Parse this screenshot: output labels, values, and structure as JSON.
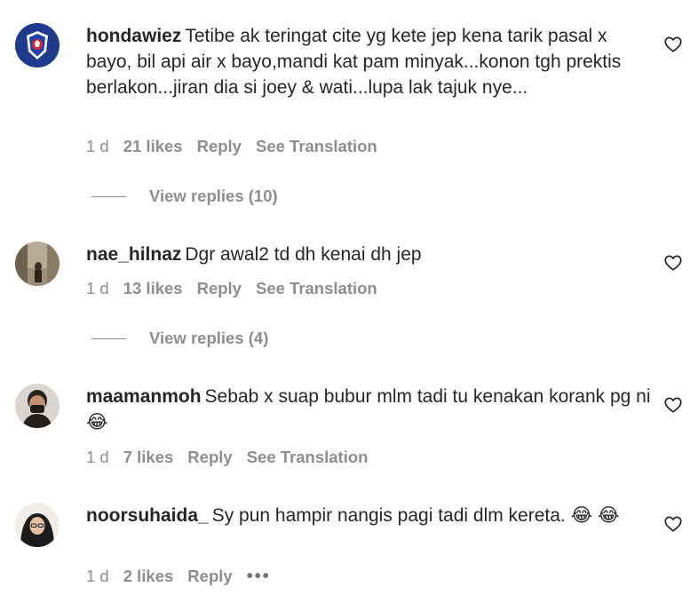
{
  "comments": [
    {
      "username": "hondawiez",
      "text": "Tetibe ak teringat cite yg kete jep kena tarik pasal x bayo, bil api air x bayo,mandi kat pam minyak...konon tgh prektis berlakon...jiran dia si joey & wati...lupa lak tajuk nye...",
      "time": "1 d",
      "likes": "21 likes",
      "reply": "Reply",
      "translate": "See Translation",
      "view_replies": "View replies (10)"
    },
    {
      "username": "nae_hilnaz",
      "text": "Dgr awal2 td dh kenai dh jep",
      "time": "1 d",
      "likes": "13 likes",
      "reply": "Reply",
      "translate": "See Translation",
      "view_replies": "View replies (4)"
    },
    {
      "username": "maamanmoh",
      "text": "Sebab x suap bubur mlm tadi tu kenakan korank pg ni😂",
      "time": "1 d",
      "likes": "7 likes",
      "reply": "Reply",
      "translate": "See Translation"
    },
    {
      "username": "noorsuhaida_",
      "text": "Sy pun hampir nangis pagi tadi dlm kereta. 😂 😂",
      "time": "1 d",
      "likes": "2 likes",
      "reply": "Reply",
      "more": "•••"
    }
  ],
  "icons": {
    "like": "heart-outline-icon",
    "more": "more-options-icon"
  },
  "colors": {
    "text": "#262626",
    "secondary": "#8e8e8e",
    "background": "#ffffff"
  }
}
